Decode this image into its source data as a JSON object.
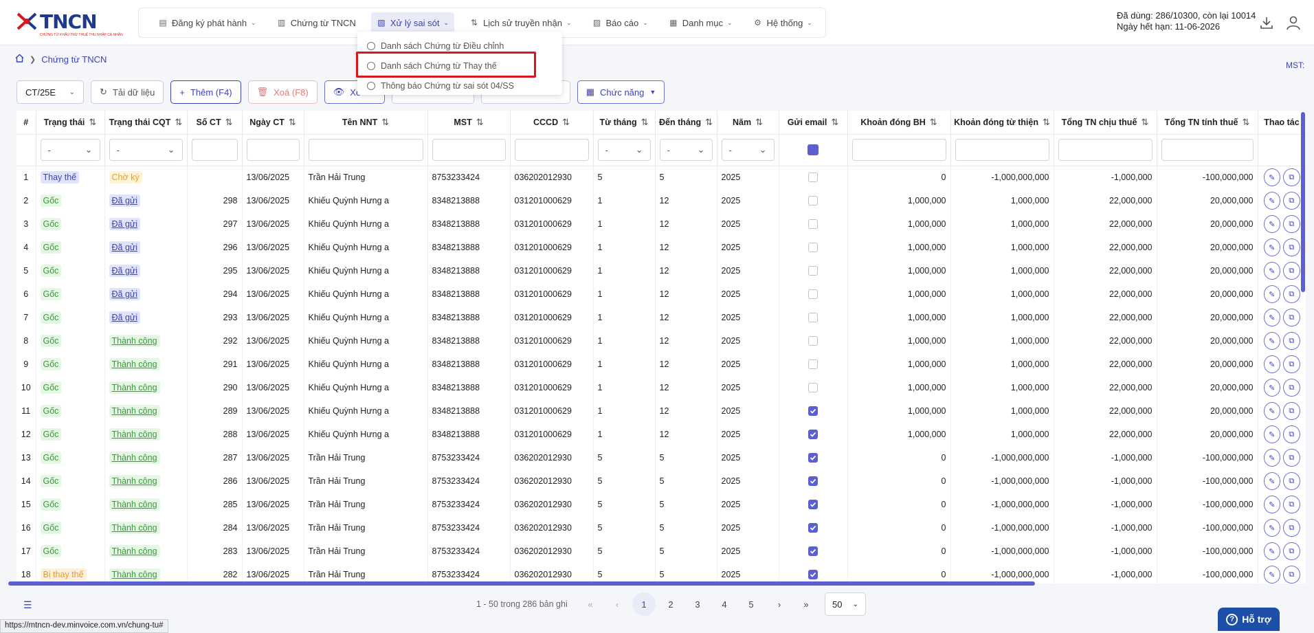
{
  "app": {
    "logo_text": "TNCN",
    "logo_sub": "CHỨNG TỪ KHẤU TRỪ THUẾ THU NHẬP CÁ NHÂN"
  },
  "nav": [
    {
      "label": "Đăng ký phát hành",
      "icon": "document-edit-icon",
      "chevron": true
    },
    {
      "label": "Chứng từ TNCN",
      "icon": "document-icon",
      "chevron": false
    },
    {
      "label": "Xử lý sai sót",
      "icon": "document-search-icon",
      "chevron": true,
      "active": true
    },
    {
      "label": "Lịch sử truyền nhận",
      "icon": "transfer-icon",
      "chevron": true
    },
    {
      "label": "Báo cáo",
      "icon": "chart-icon",
      "chevron": true
    },
    {
      "label": "Danh mục",
      "icon": "grid-icon",
      "chevron": true
    },
    {
      "label": "Hệ thống",
      "icon": "gear-icon",
      "chevron": true
    }
  ],
  "usage": {
    "line1": "Đã dùng: 286/10300, còn lại 10014",
    "line2": "Ngày hết hạn: 11-06-2026"
  },
  "breadcrumb": {
    "current": "Chứng từ TNCN"
  },
  "mst_label": "MST:",
  "dropdown": {
    "items": [
      "Danh sách Chứng từ Điều chỉnh",
      "Danh sách Chứng từ Thay thế",
      "Thông báo Chứng từ sai sót 04/SS"
    ]
  },
  "toolbar": {
    "series": "CT/25E",
    "reload": "Tải dữ liệu",
    "add": "Thêm (F4)",
    "delete": "Xoá (F8)",
    "view": "Xe",
    "functions": "Chức năng"
  },
  "columns": [
    "#",
    "Trạng thái",
    "Trạng thái CQT",
    "Số CT",
    "Ngày CT",
    "Tên NNT",
    "MST",
    "CCCD",
    "Từ tháng",
    "Đến tháng",
    "Năm",
    "Gửi email",
    "Khoản đóng BH",
    "Khoản đóng từ thiện",
    "Tổng TN chịu thuế",
    "Tổng TN tính thuế",
    "Thao tác"
  ],
  "filter_placeholder": "-",
  "rows": [
    {
      "no": "1",
      "status": "Thay thế",
      "st": "thay",
      "cqt": "Chờ ký",
      "cq": "cho",
      "so": "",
      "ngay": "13/06/2025",
      "ten": "Trần Hải Trung",
      "mst": "8753233424",
      "cccd": "036202012930",
      "tu": "5",
      "den": "5",
      "nam": "2025",
      "email": false,
      "bh": "0",
      "tt": "-1,000,000,000",
      "chiu": "-1,000,000",
      "tinh": "-100,000,000"
    },
    {
      "no": "2",
      "status": "Gốc",
      "st": "goc",
      "cqt": "Đã gửi",
      "cq": "dagui",
      "so": "298",
      "ngay": "13/06/2025",
      "ten": "Khiếu Quỳnh Hưng a",
      "mst": "8348213888",
      "cccd": "031201000629",
      "tu": "1",
      "den": "12",
      "nam": "2025",
      "email": false,
      "bh": "1,000,000",
      "tt": "1,000,000",
      "chiu": "22,000,000",
      "tinh": "20,000,000"
    },
    {
      "no": "3",
      "status": "Gốc",
      "st": "goc",
      "cqt": "Đã gửi",
      "cq": "dagui",
      "so": "297",
      "ngay": "13/06/2025",
      "ten": "Khiếu Quỳnh Hưng a",
      "mst": "8348213888",
      "cccd": "031201000629",
      "tu": "1",
      "den": "12",
      "nam": "2025",
      "email": false,
      "bh": "1,000,000",
      "tt": "1,000,000",
      "chiu": "22,000,000",
      "tinh": "20,000,000"
    },
    {
      "no": "4",
      "status": "Gốc",
      "st": "goc",
      "cqt": "Đã gửi",
      "cq": "dagui",
      "so": "296",
      "ngay": "13/06/2025",
      "ten": "Khiếu Quỳnh Hưng a",
      "mst": "8348213888",
      "cccd": "031201000629",
      "tu": "1",
      "den": "12",
      "nam": "2025",
      "email": false,
      "bh": "1,000,000",
      "tt": "1,000,000",
      "chiu": "22,000,000",
      "tinh": "20,000,000"
    },
    {
      "no": "5",
      "status": "Gốc",
      "st": "goc",
      "cqt": "Đã gửi",
      "cq": "dagui",
      "so": "295",
      "ngay": "13/06/2025",
      "ten": "Khiếu Quỳnh Hưng a",
      "mst": "8348213888",
      "cccd": "031201000629",
      "tu": "1",
      "den": "12",
      "nam": "2025",
      "email": false,
      "bh": "1,000,000",
      "tt": "1,000,000",
      "chiu": "22,000,000",
      "tinh": "20,000,000"
    },
    {
      "no": "6",
      "status": "Gốc",
      "st": "goc",
      "cqt": "Đã gửi",
      "cq": "dagui",
      "so": "294",
      "ngay": "13/06/2025",
      "ten": "Khiếu Quỳnh Hưng a",
      "mst": "8348213888",
      "cccd": "031201000629",
      "tu": "1",
      "den": "12",
      "nam": "2025",
      "email": false,
      "bh": "1,000,000",
      "tt": "1,000,000",
      "chiu": "22,000,000",
      "tinh": "20,000,000"
    },
    {
      "no": "7",
      "status": "Gốc",
      "st": "goc",
      "cqt": "Đã gửi",
      "cq": "dagui",
      "so": "293",
      "ngay": "13/06/2025",
      "ten": "Khiếu Quỳnh Hưng a",
      "mst": "8348213888",
      "cccd": "031201000629",
      "tu": "1",
      "den": "12",
      "nam": "2025",
      "email": false,
      "bh": "1,000,000",
      "tt": "1,000,000",
      "chiu": "22,000,000",
      "tinh": "20,000,000"
    },
    {
      "no": "8",
      "status": "Gốc",
      "st": "goc",
      "cqt": "Thành công",
      "cq": "tc",
      "so": "292",
      "ngay": "13/06/2025",
      "ten": "Khiếu Quỳnh Hưng a",
      "mst": "8348213888",
      "cccd": "031201000629",
      "tu": "1",
      "den": "12",
      "nam": "2025",
      "email": false,
      "bh": "1,000,000",
      "tt": "1,000,000",
      "chiu": "22,000,000",
      "tinh": "20,000,000"
    },
    {
      "no": "9",
      "status": "Gốc",
      "st": "goc",
      "cqt": "Thành công",
      "cq": "tc",
      "so": "291",
      "ngay": "13/06/2025",
      "ten": "Khiếu Quỳnh Hưng a",
      "mst": "8348213888",
      "cccd": "031201000629",
      "tu": "1",
      "den": "12",
      "nam": "2025",
      "email": false,
      "bh": "1,000,000",
      "tt": "1,000,000",
      "chiu": "22,000,000",
      "tinh": "20,000,000"
    },
    {
      "no": "10",
      "status": "Gốc",
      "st": "goc",
      "cqt": "Thành công",
      "cq": "tc",
      "so": "290",
      "ngay": "13/06/2025",
      "ten": "Khiếu Quỳnh Hưng a",
      "mst": "8348213888",
      "cccd": "031201000629",
      "tu": "1",
      "den": "12",
      "nam": "2025",
      "email": false,
      "bh": "1,000,000",
      "tt": "1,000,000",
      "chiu": "22,000,000",
      "tinh": "20,000,000"
    },
    {
      "no": "11",
      "status": "Gốc",
      "st": "goc",
      "cqt": "Thành công",
      "cq": "tc",
      "so": "289",
      "ngay": "13/06/2025",
      "ten": "Khiếu Quỳnh Hưng a",
      "mst": "8348213888",
      "cccd": "031201000629",
      "tu": "1",
      "den": "12",
      "nam": "2025",
      "email": true,
      "bh": "1,000,000",
      "tt": "1,000,000",
      "chiu": "22,000,000",
      "tinh": "20,000,000"
    },
    {
      "no": "12",
      "status": "Gốc",
      "st": "goc",
      "cqt": "Thành công",
      "cq": "tc",
      "so": "288",
      "ngay": "13/06/2025",
      "ten": "Khiếu Quỳnh Hưng a",
      "mst": "8348213888",
      "cccd": "031201000629",
      "tu": "1",
      "den": "12",
      "nam": "2025",
      "email": true,
      "bh": "1,000,000",
      "tt": "1,000,000",
      "chiu": "22,000,000",
      "tinh": "20,000,000"
    },
    {
      "no": "13",
      "status": "Gốc",
      "st": "goc",
      "cqt": "Thành công",
      "cq": "tc",
      "so": "287",
      "ngay": "13/06/2025",
      "ten": "Trần Hải Trung",
      "mst": "8753233424",
      "cccd": "036202012930",
      "tu": "5",
      "den": "5",
      "nam": "2025",
      "email": true,
      "bh": "0",
      "tt": "-1,000,000,000",
      "chiu": "-1,000,000",
      "tinh": "-100,000,000"
    },
    {
      "no": "14",
      "status": "Gốc",
      "st": "goc",
      "cqt": "Thành công",
      "cq": "tc",
      "so": "286",
      "ngay": "13/06/2025",
      "ten": "Trần Hải Trung",
      "mst": "8753233424",
      "cccd": "036202012930",
      "tu": "5",
      "den": "5",
      "nam": "2025",
      "email": true,
      "bh": "0",
      "tt": "-1,000,000,000",
      "chiu": "-1,000,000",
      "tinh": "-100,000,000"
    },
    {
      "no": "15",
      "status": "Gốc",
      "st": "goc",
      "cqt": "Thành công",
      "cq": "tc",
      "so": "285",
      "ngay": "13/06/2025",
      "ten": "Trần Hải Trung",
      "mst": "8753233424",
      "cccd": "036202012930",
      "tu": "5",
      "den": "5",
      "nam": "2025",
      "email": true,
      "bh": "0",
      "tt": "-1,000,000,000",
      "chiu": "-1,000,000",
      "tinh": "-100,000,000"
    },
    {
      "no": "16",
      "status": "Gốc",
      "st": "goc",
      "cqt": "Thành công",
      "cq": "tc",
      "so": "284",
      "ngay": "13/06/2025",
      "ten": "Trần Hải Trung",
      "mst": "8753233424",
      "cccd": "036202012930",
      "tu": "5",
      "den": "5",
      "nam": "2025",
      "email": true,
      "bh": "0",
      "tt": "-1,000,000,000",
      "chiu": "-1,000,000",
      "tinh": "-100,000,000"
    },
    {
      "no": "17",
      "status": "Gốc",
      "st": "goc",
      "cqt": "Thành công",
      "cq": "tc",
      "so": "283",
      "ngay": "13/06/2025",
      "ten": "Trần Hải Trung",
      "mst": "8753233424",
      "cccd": "036202012930",
      "tu": "5",
      "den": "5",
      "nam": "2025",
      "email": true,
      "bh": "0",
      "tt": "-1,000,000,000",
      "chiu": "-1,000,000",
      "tinh": "-100,000,000"
    },
    {
      "no": "18",
      "status": "Bị thay thế",
      "st": "bithay",
      "cqt": "Thành công",
      "cq": "tc",
      "so": "282",
      "ngay": "13/06/2025",
      "ten": "Trần Hải Trung",
      "mst": "8753233424",
      "cccd": "036202012930",
      "tu": "5",
      "den": "5",
      "nam": "2025",
      "email": true,
      "bh": "0",
      "tt": "-1,000,000,000",
      "chiu": "-1,000,000",
      "tinh": "-100,000,000"
    }
  ],
  "pagination": {
    "info": "1 - 50 trong 286 bản ghi",
    "pages": [
      "1",
      "2",
      "3",
      "4",
      "5"
    ],
    "current": "1",
    "page_size": "50"
  },
  "help_label": "Hỗ trợ",
  "status_url": "https://mtncn-dev.minvoice.com.vn/chung-tu#",
  "colors": {
    "accent": "#3d42b5",
    "highlight": "#d9161e",
    "help": "#1e4fa8"
  }
}
